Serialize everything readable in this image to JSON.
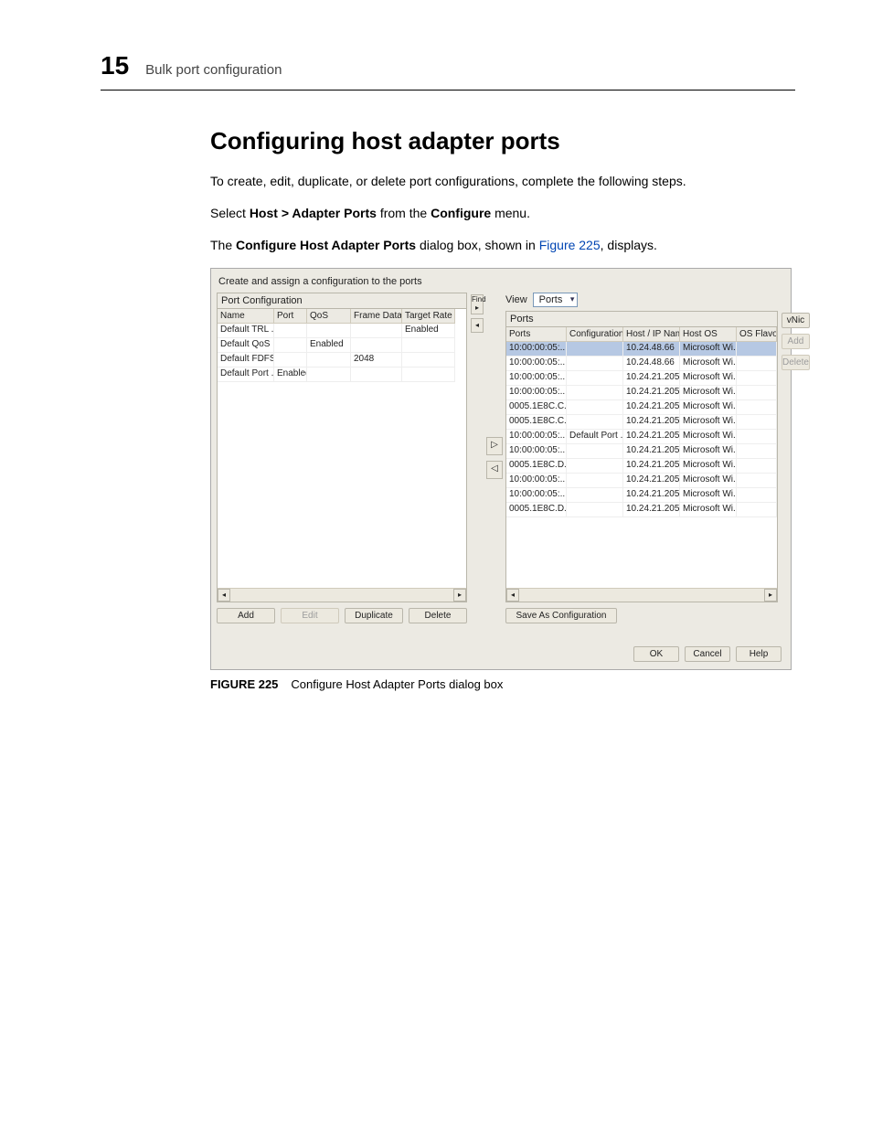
{
  "chapter": {
    "number": "15",
    "title": "Bulk port configuration"
  },
  "heading": "Configuring host adapter ports",
  "intro": "To create, edit, duplicate, or delete port configurations, complete the following steps.",
  "step": {
    "prefix": "Select ",
    "bold1": "Host > Adapter Ports",
    "mid": " from the ",
    "bold2": "Configure",
    "suffix": " menu."
  },
  "confirm": {
    "prefix": "The ",
    "bold": "Configure Host Adapter Ports",
    "mid": " dialog box, shown in ",
    "link": "Figure 225",
    "suffix": ", displays."
  },
  "figure": {
    "label": "FIGURE 225",
    "caption": "Configure Host Adapter Ports dialog box"
  },
  "dialog": {
    "instruction": "Create and assign a configuration to the ports",
    "left_title": "Port Configuration",
    "right_title": "Ports",
    "find_label": "Find",
    "view_label": "View",
    "view_value": "Ports",
    "left_headers": [
      "Name",
      "Port",
      "QoS",
      "Frame Data ...",
      "Target Rate"
    ],
    "left_rows": [
      [
        "Default TRL ...",
        "",
        "",
        "",
        "Enabled"
      ],
      [
        "Default QoS ...",
        "",
        "Enabled",
        "",
        ""
      ],
      [
        "Default FDFS...",
        "",
        "",
        "2048",
        ""
      ],
      [
        "Default Port ...",
        "Enabled",
        "",
        "",
        ""
      ]
    ],
    "right_headers": [
      "Ports",
      "Configuration...",
      "Host / IP Name",
      "Host OS",
      "OS Flavor"
    ],
    "right_rows": [
      [
        "10:00:00:05:...",
        "",
        "10.24.48.66",
        "Microsoft Wi...",
        ""
      ],
      [
        "10:00:00:05:...",
        "",
        "10.24.48.66",
        "Microsoft Wi...",
        ""
      ],
      [
        "10:00:00:05:...",
        "",
        "10.24.21.205",
        "Microsoft Wi...",
        ""
      ],
      [
        "10:00:00:05:...",
        "",
        "10.24.21.205",
        "Microsoft Wi...",
        ""
      ],
      [
        "0005.1E8C.C...",
        "",
        "10.24.21.205",
        "Microsoft Wi...",
        ""
      ],
      [
        "0005.1E8C.C...",
        "",
        "10.24.21.205",
        "Microsoft Wi...",
        ""
      ],
      [
        "10:00:00:05:...",
        "Default Port ...",
        "10.24.21.205",
        "Microsoft Wi...",
        ""
      ],
      [
        "10:00:00:05:...",
        "",
        "10.24.21.205",
        "Microsoft Wi...",
        ""
      ],
      [
        "0005.1E8C.D...",
        "",
        "10.24.21.205",
        "Microsoft Wi...",
        ""
      ],
      [
        "10:00:00:05:...",
        "",
        "10.24.21.205",
        "Microsoft Wi...",
        ""
      ],
      [
        "10:00:00:05:...",
        "",
        "10.24.21.205",
        "Microsoft Wi...",
        ""
      ],
      [
        "0005.1E8C.D...",
        "",
        "10.24.21.205",
        "Microsoft Wi...",
        ""
      ]
    ],
    "left_buttons": {
      "add": "Add",
      "edit": "Edit",
      "duplicate": "Duplicate",
      "delete": "Delete"
    },
    "right_button": "Save As Configuration",
    "side_buttons": {
      "vnic": "vNic",
      "add": "Add",
      "delete": "Delete"
    },
    "footer": {
      "ok": "OK",
      "cancel": "Cancel",
      "help": "Help"
    },
    "arrows": {
      "right": "▷",
      "left": "◁",
      "scroll_left": "◂",
      "scroll_right": "▸",
      "find_arrow": "▸",
      "collapse": "◂"
    }
  }
}
